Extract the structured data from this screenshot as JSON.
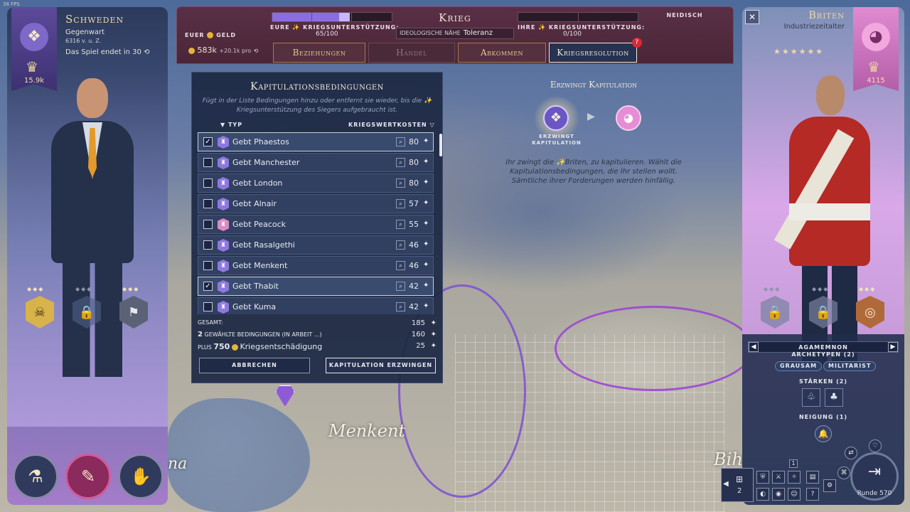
{
  "fps": "38 FPS",
  "map": {
    "labels": [
      "Menkent",
      "Biham",
      "na"
    ]
  },
  "left_leader": {
    "civ_name": "Schweden",
    "era": "Gegenwart",
    "date": "6316 v. u. Z.",
    "game_end": "Das Spiel endet in 30",
    "score": "15.9k",
    "bottom_buttons": [
      "science-flask-icon",
      "scroll-icon",
      "hands-icon"
    ]
  },
  "right_leader": {
    "civ_name": "Briten",
    "era": "Industriezeitalter",
    "stars": "★★★★★★",
    "score": "4115",
    "leader_name": "AGAMEMNON",
    "archetypes_label": "ARCHETYPEN (2)",
    "archetypes": [
      "GRAUSAM",
      "MILITARIST"
    ],
    "strengths_label": "STÄRKEN (2)",
    "inclination_label": "NEIGUNG (1)"
  },
  "war_panel": {
    "title": "Krieg",
    "your_support_label": "EURE ✨ KRIEGSUNTERSTÜTZUNG:",
    "your_support_value": "65/100",
    "your_support_fraction": 0.65,
    "their_support_label": "IHRE ✨ KRIEGSUNTERSTÜTZUNG:",
    "their_support_value": "0/100",
    "their_support_fraction": 0.0,
    "mood": "NEIDISCH",
    "ideology_label": "IDEOLOGISCHE NÄHE",
    "ideology_value": "Toleranz",
    "gold_label": "EUER",
    "gold_word": "GELD",
    "gold_amount": "583k",
    "gold_rate": "+20.1k pro",
    "tabs": [
      {
        "label": "Beziehungen",
        "state": "normal"
      },
      {
        "label": "Handel",
        "state": "inactive"
      },
      {
        "label": "Abkommen",
        "state": "normal"
      },
      {
        "label": "Kriegsresolution",
        "state": "active",
        "badge": "?"
      }
    ]
  },
  "capitulation": {
    "title": "Kapitulationsbedingungen",
    "description": "Fügt in der Liste Bedingungen hinzu oder entfernt sie wieder, bis die ✨ Kriegsunterstützung des Siegers aufgebraucht ist.",
    "col_type": "▼ TYP",
    "col_cost": "KRIEGSWERTKOSTEN ▽",
    "rows": [
      {
        "label": "Gebt Phaestos",
        "cost": "80",
        "checked": true,
        "pink": false
      },
      {
        "label": "Gebt Manchester",
        "cost": "80",
        "checked": false,
        "pink": false
      },
      {
        "label": "Gebt London",
        "cost": "80",
        "checked": false,
        "pink": false
      },
      {
        "label": "Gebt Alnair",
        "cost": "57",
        "checked": false,
        "pink": false
      },
      {
        "label": "Gebt Peacock",
        "cost": "55",
        "checked": false,
        "pink": true
      },
      {
        "label": "Gebt Rasalgethi",
        "cost": "46",
        "checked": false,
        "pink": false
      },
      {
        "label": "Gebt Menkent",
        "cost": "46",
        "checked": false,
        "pink": false
      },
      {
        "label": "Gebt Thabit",
        "cost": "42",
        "checked": true,
        "pink": false
      },
      {
        "label": "Gebt Kuma",
        "cost": "42",
        "checked": false,
        "pink": false
      }
    ],
    "total_label": "GESAMT:",
    "total_value": "185",
    "selected_count": "2",
    "selected_label": "GEWÄHLTE BEDINGUNGEN (IN ARBEIT ...)",
    "selected_value": "160",
    "plus_label": "PLUS",
    "plus_amount": "750",
    "reparations_label": "Kriegsentschädigung",
    "reparations_value": "25",
    "cancel_label": "ABBRECHEN",
    "force_label": "KAPITULATION ERZWINGEN"
  },
  "force_info": {
    "title": "Erzwingt Kapitulation",
    "emblem_caption": "ERZWINGT KAPITULATION",
    "description": "Ihr zwingt die ✨Briten, zu kapitulieren. Wählt die Kapitulationsbedingungen, die Ihr stellen wollt. Sämtliche ihrer Forderungen werden hinfällig."
  },
  "hud": {
    "turn_label": "Runde 570",
    "queue_count": "2",
    "notif_count": "1"
  },
  "colors": {
    "war_panel": "#4a2638",
    "support_fill": "#8a6ee0",
    "panel_bg": "#1d2944",
    "accent_gold": "#e8c890"
  }
}
